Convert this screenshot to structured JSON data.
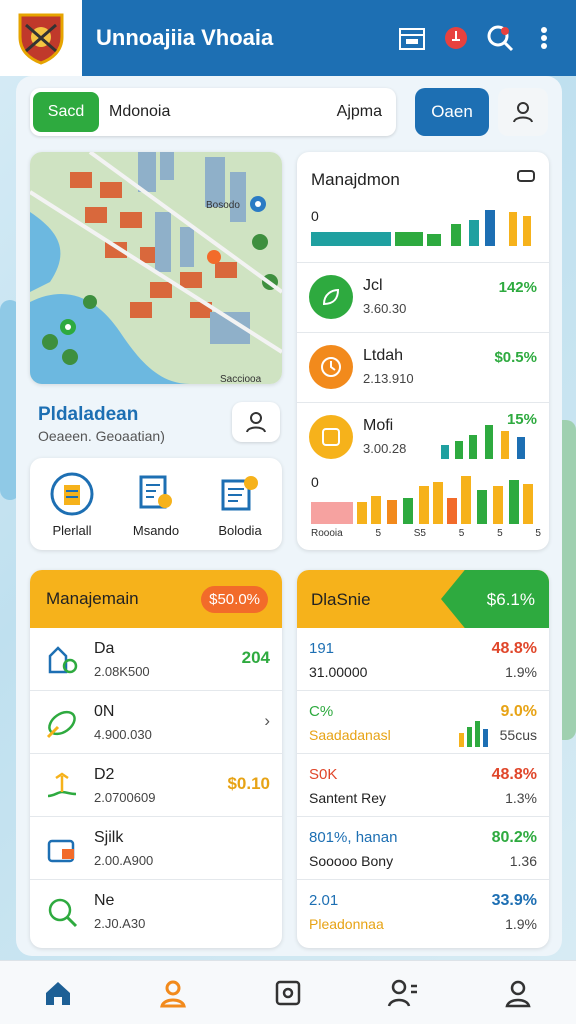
{
  "app": {
    "title": "Unnoajiia Vhoaia"
  },
  "colors": {
    "primary": "#1d6fb3",
    "green": "#2eaa3f",
    "orange": "#f6b21b",
    "red": "#f26b2a"
  },
  "search": {
    "button": "Sacd",
    "value": "Mdonoia",
    "right": "Ajpma"
  },
  "open_button": "Oaen",
  "info": {
    "title": "Pldaladean",
    "subtitle": "Oeaeen. Geoaatian)"
  },
  "quick": [
    {
      "label": "Plerlall",
      "icon": "headset-icon"
    },
    {
      "label": "Msando",
      "icon": "document-search-icon"
    },
    {
      "label": "Bolodia",
      "icon": "report-icon"
    }
  ],
  "right_card": {
    "title": "Manajdmon",
    "axis_top": "0",
    "axis_bottom": "0",
    "rows": [
      {
        "name": "Jcl",
        "value": "3.60.30",
        "pct": "142%",
        "icon": "leaf-icon"
      },
      {
        "name": "Ltdah",
        "value": "2.13.910",
        "pct": "$0.5%",
        "icon": "timer-icon"
      },
      {
        "name": "Mofi",
        "value": "3.00.28",
        "pct": "15%",
        "icon": "clock-icon"
      }
    ],
    "tick_labels": [
      "Roooia",
      "5",
      "S5",
      "5",
      "5",
      "5"
    ]
  },
  "left_list": {
    "title": "Manajemain",
    "badge": "$50.0%",
    "rows": [
      {
        "name": "Da",
        "value": "2.08K500",
        "right": "204",
        "icon": "tools-icon"
      },
      {
        "name": "0N",
        "value": "4.900.030",
        "right": "",
        "icon": "leaf-pencil-icon"
      },
      {
        "name": "D2",
        "value": "2.0700609",
        "right": "$0.10",
        "icon": "plant-hand-icon"
      },
      {
        "name": "Sjilk",
        "value": "2.00.A900",
        "right": "",
        "icon": "toolbox-icon"
      },
      {
        "name": "Ne",
        "value": "2.J0.A30",
        "right": "",
        "icon": "search-leaf-icon"
      }
    ]
  },
  "metrics": {
    "title": "DlaSnie",
    "value": "$6.1%",
    "rows": [
      {
        "name": "191",
        "sub": "31.00000",
        "p1": "48.8%",
        "p2": "1.9%",
        "name_color": "#1d6fb3",
        "p1_color": "#e0462a"
      },
      {
        "name": "C%",
        "sub": "Saadadanasl",
        "p1": "9.0%",
        "p2": "55cus",
        "name_color": "#2eaa3f",
        "p1_color": "#e7a315"
      },
      {
        "name": "S0K",
        "sub": "Santent Rey",
        "p1": "48.8%",
        "p2": "1.3%",
        "name_color": "#e0462a",
        "p1_color": "#e0462a"
      },
      {
        "name": "801%, hanan",
        "sub": "Sooooo Bony",
        "p1": "80.2%",
        "p2": "1.36",
        "name_color": "#1d6fb3",
        "p1_color": "#2eaa3f"
      },
      {
        "name": "2.01",
        "sub": "Pleadonnaa",
        "p1": "33.9%",
        "p2": "1.9%",
        "name_color": "#1d6fb3",
        "p1_color": "#1d6fb3"
      }
    ]
  },
  "nav": [
    "home-icon",
    "user-icon",
    "camera-icon",
    "profile-settings-icon",
    "account-icon"
  ],
  "map": {
    "labels": [
      "Bosodo",
      "Sacciooa"
    ]
  }
}
